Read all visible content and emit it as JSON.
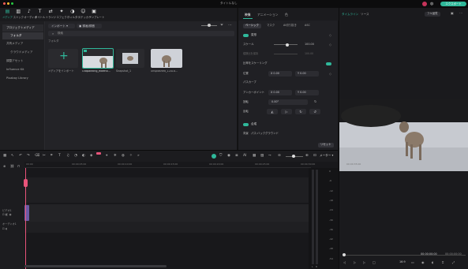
{
  "app": {
    "title": "タイトルなし",
    "export_label": "エクスポート"
  },
  "toolbar": {
    "items": [
      {
        "label": "メディア",
        "icon": "media-icon"
      },
      {
        "label": "ストック",
        "icon": "stock-icon"
      },
      {
        "label": "オーディオ",
        "icon": "audio-icon"
      },
      {
        "label": "タイトル",
        "icon": "title-icon"
      },
      {
        "label": "トランジ",
        "icon": "transition-icon"
      },
      {
        "label": "エフェクト",
        "icon": "effect-icon"
      },
      {
        "label": "フィルター",
        "icon": "filter-icon"
      },
      {
        "label": "ステッカー",
        "icon": "sticker-icon"
      },
      {
        "label": "テンプレート",
        "icon": "template-icon"
      }
    ]
  },
  "sidebar": {
    "items": [
      {
        "label": "プロジェクトメディア"
      },
      {
        "label": "フォルダ"
      },
      {
        "label": "共有メディア"
      },
      {
        "label": "クラウドメディア"
      },
      {
        "label": "調整アセット"
      },
      {
        "label": "Influence Kit"
      },
      {
        "label": "Pixabay Library"
      }
    ]
  },
  "media": {
    "import_label": "インポート",
    "record_label": "録画/録音",
    "search_placeholder": "検索",
    "folder_label": "フォルダ",
    "import_tile_label": "メディアをインポート",
    "items": [
      {
        "name": "Outpainting_extend..."
      },
      {
        "name": "Snapshot_1"
      },
      {
        "name": "unsplashed_12018..."
      }
    ]
  },
  "properties": {
    "tabs": [
      "映像",
      "アニメーション",
      "色"
    ],
    "subtabs": [
      "ベーシック",
      "マスク",
      "AI切り抜き",
      "ASC"
    ],
    "transform_label": "変形",
    "scale_label": "スケール",
    "scale_value": "100.00",
    "uniform_label": "縦横比を保持",
    "uniform_value": "100.00",
    "ratio_label": "比率をスケーリング",
    "position_label": "位置",
    "pos_x": "0.00",
    "pos_y": "0.00",
    "pos_axis_x": "X",
    "pos_axis_y": "Y",
    "path_label": "パスカーブ",
    "anchor_label": "アンカーポイント",
    "anchor_x": "0.00",
    "anchor_y": "0.00",
    "rotate_label": "回転",
    "rotate_value": "0.00°",
    "flip_label": "反転",
    "compositing_label": "合成",
    "background_label": "背景",
    "background_value": "パス:バックグラウンド",
    "reset_label": "リセット"
  },
  "preview": {
    "tabs": [
      "タイムライン",
      "ソース"
    ],
    "quality_label": "フル品質",
    "current_time": "00:00:00:00",
    "total_time": "00:00:00:00",
    "zoom_label": "16:9"
  },
  "timeline": {
    "meter_label": "メーター",
    "ruler": [
      "00:00",
      "00:00:05:00",
      "00:00:10:00",
      "00:00:15:00",
      "00:00:20:00",
      "00:00:25:00",
      "00:00:30:00",
      "00:00:35:00"
    ],
    "tracks": [
      "ビデオ1",
      "オーディオ1"
    ],
    "db_scale": [
      "0",
      "-6",
      "-12",
      "-18",
      "-24",
      "-30",
      "-36",
      "-42",
      "-48",
      "-54"
    ],
    "lr": [
      "L",
      "R"
    ]
  },
  "colors": {
    "accent": "#2fb89a",
    "playhead": "#e8547a"
  }
}
